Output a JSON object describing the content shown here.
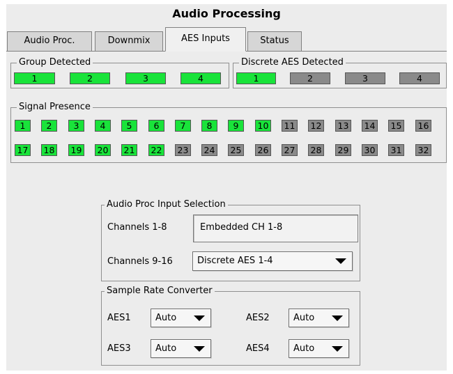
{
  "title": "Audio Processing",
  "tabs": [
    {
      "label": "Audio Proc."
    },
    {
      "label": "Downmix"
    },
    {
      "label": "AES Inputs"
    },
    {
      "label": "Status"
    }
  ],
  "group_detected": {
    "legend": "Group Detected",
    "items": [
      {
        "label": "1",
        "state": "on"
      },
      {
        "label": "2",
        "state": "on"
      },
      {
        "label": "3",
        "state": "on"
      },
      {
        "label": "4",
        "state": "on"
      }
    ]
  },
  "discrete_detected": {
    "legend": "Discrete AES Detected",
    "items": [
      {
        "label": "1",
        "state": "on"
      },
      {
        "label": "2",
        "state": "off"
      },
      {
        "label": "3",
        "state": "off"
      },
      {
        "label": "4",
        "state": "off"
      }
    ]
  },
  "signal_presence": {
    "legend": "Signal Presence",
    "row1": [
      "1",
      "2",
      "3",
      "4",
      "5",
      "6",
      "7",
      "8",
      "9",
      "10",
      "11",
      "12",
      "13",
      "14",
      "15",
      "16"
    ],
    "row2": [
      "17",
      "18",
      "19",
      "20",
      "21",
      "22",
      "23",
      "24",
      "25",
      "26",
      "27",
      "28",
      "29",
      "30",
      "31",
      "32"
    ],
    "active_count": 10,
    "active_count_row2": 6
  },
  "input_selection": {
    "legend": "Audio Proc Input Selection",
    "ch1_label": "Channels 1-8",
    "ch1_value": "Embedded CH 1-8",
    "ch9_label": "Channels 9-16",
    "ch9_value": "Discrete AES 1-4"
  },
  "src": {
    "legend": "Sample Rate Converter",
    "aes1_label": "AES1",
    "aes1_value": "Auto",
    "aes2_label": "AES2",
    "aes2_value": "Auto",
    "aes3_label": "AES3",
    "aes3_value": "Auto",
    "aes4_label": "AES4",
    "aes4_value": "Auto"
  },
  "colors": {
    "on": "#19e33a",
    "off": "#8a8a8a"
  }
}
